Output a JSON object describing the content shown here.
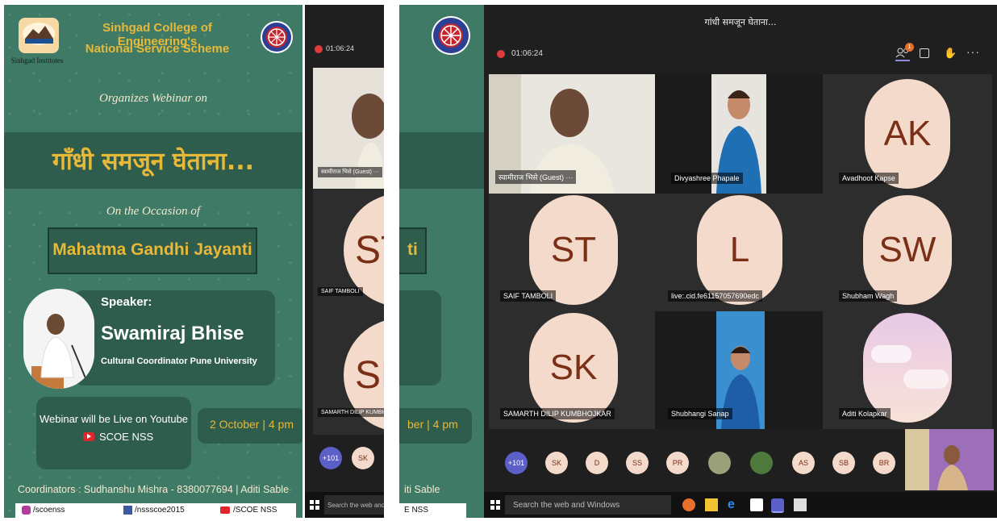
{
  "poster": {
    "college_line1": "Sinhgad College of Engineering's",
    "college_line2": "National Service Scheme",
    "logo_caption": "Sinhgad Institutes",
    "organizes": "Organizes Webinar on",
    "title_marathi": "गाँधी समजून घेताना...",
    "occasion": "On the Occasion of",
    "event": "Mahatma Gandhi Jayanti",
    "speaker_label": "Speaker:",
    "speaker_name": "Swamiraj Bhise",
    "speaker_role": "Cultural Coordinator Pune University",
    "live_text": "Webinar will be Live on Youtube",
    "yt_channel": "SCOE NSS",
    "date": "2 October | 4 pm",
    "coordinators": "Coordinators : Sudhanshu Mishra - 8380077694 | Aditi Sable",
    "social_ig": "/scoenss",
    "social_fb": "/nssscoe2015",
    "social_yt": "/SCOE NSS"
  },
  "middle": {
    "timer": "01:06:24",
    "guest_tag": "स्वामीराज भिसे (Guest) ···",
    "saif_tag": "SAIF TAMBOLI",
    "samarth_tag": "SAMARTH DILIP KUMBHOJKAR",
    "st": "ST",
    "sk": "SK",
    "p101": "+101",
    "psk": "SK",
    "search": "Search the web and W",
    "poster_fragment_ti": "ti",
    "poster_fragment_date": "ber | 4 pm",
    "poster_fragment_sable": "iti Sable",
    "poster_fragment_nss": "E NSS"
  },
  "meeting": {
    "title": "गांधी समजून घेताना...",
    "timer": "01:06:24",
    "tiles": [
      {
        "name": "स्वामीराज भिसे (Guest) ···",
        "initials": ""
      },
      {
        "name": "Divyashree Phapale",
        "initials": ""
      },
      {
        "name": "Avadhoot Kapse",
        "initials": "AK"
      },
      {
        "name": "SAIF TAMBOLI",
        "initials": "ST"
      },
      {
        "name": "live:.cid.fe61157057690edc",
        "initials": "L"
      },
      {
        "name": "Shubham Wagh",
        "initials": "SW"
      },
      {
        "name": "SAMARTH DILIP KUMBHOJKAR",
        "initials": "SK"
      },
      {
        "name": "Shubhangi Sanap",
        "initials": ""
      },
      {
        "name": "Aditi Kolapkar",
        "initials": ""
      }
    ],
    "participants": [
      "+101",
      "SK",
      "D",
      "SS",
      "PR",
      "",
      "",
      "AS",
      "SB",
      "BR"
    ],
    "participant_badge": "1",
    "search_placeholder": "Search the web and Windows"
  },
  "colors": {
    "poster_green": "#3f7a66",
    "gold": "#e8b838",
    "teams_bg": "#1f1f1f",
    "avatar_bg": "#f3dacb",
    "avatar_text": "#7a2f16"
  }
}
